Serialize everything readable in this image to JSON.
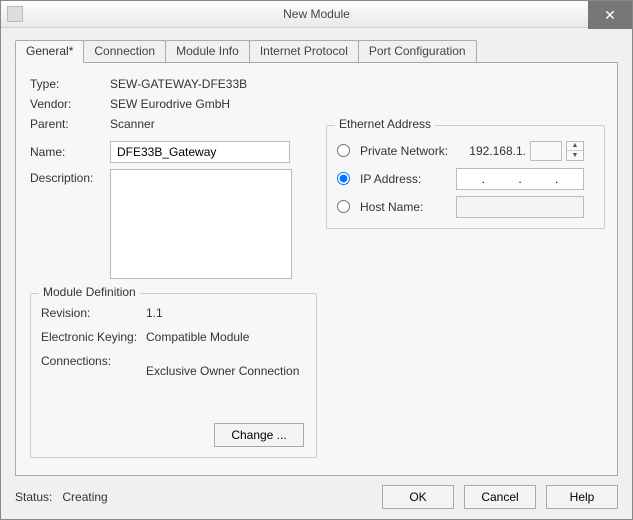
{
  "window": {
    "title": "New Module"
  },
  "tabs": {
    "general": "General*",
    "connection": "Connection",
    "module_info": "Module Info",
    "internet_protocol": "Internet Protocol",
    "port_config": "Port Configuration"
  },
  "general": {
    "labels": {
      "type": "Type:",
      "vendor": "Vendor:",
      "parent": "Parent:",
      "name": "Name:",
      "description": "Description:"
    },
    "type_value": "SEW-GATEWAY-DFE33B",
    "vendor_value": "SEW Eurodrive GmbH",
    "parent_value": "Scanner",
    "name_value": "DFE33B_Gateway",
    "description_value": ""
  },
  "ethernet": {
    "legend": "Ethernet Address",
    "private_network_label": "Private Network:",
    "private_network_prefix": "192.168.1.",
    "ip_address_label": "IP Address:",
    "ip_address_value": ".          .          .",
    "host_name_label": "Host Name:",
    "host_name_value": "",
    "selected": "ip"
  },
  "module_definition": {
    "legend": "Module Definition",
    "revision_label": "Revision:",
    "revision_value": "1.1",
    "keying_label": "Electronic Keying:",
    "keying_value": "Compatible Module",
    "connections_label": "Connections:",
    "connections_value": "Exclusive Owner Connection",
    "change_button": "Change ..."
  },
  "footer": {
    "status_label": "Status:",
    "status_value": "Creating",
    "ok": "OK",
    "cancel": "Cancel",
    "help": "Help"
  }
}
